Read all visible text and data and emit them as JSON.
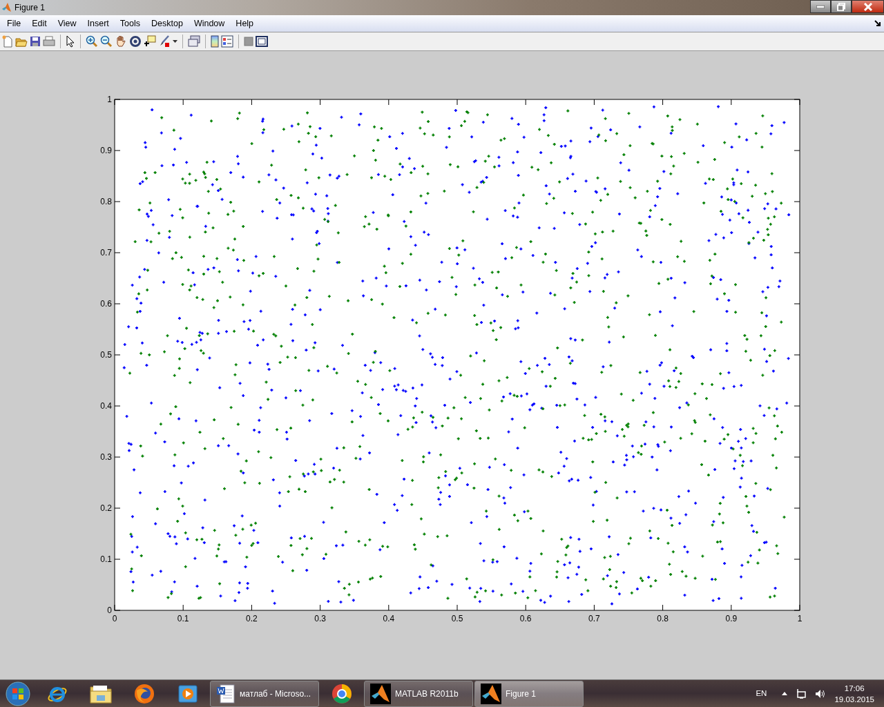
{
  "window": {
    "title": "Figure 1"
  },
  "menu": [
    {
      "label": "File"
    },
    {
      "label": "Edit"
    },
    {
      "label": "View"
    },
    {
      "label": "Insert"
    },
    {
      "label": "Tools"
    },
    {
      "label": "Desktop"
    },
    {
      "label": "Window"
    },
    {
      "label": "Help"
    }
  ],
  "axes": {
    "x_ticks": [
      "0",
      "0.1",
      "0.2",
      "0.3",
      "0.4",
      "0.5",
      "0.6",
      "0.7",
      "0.8",
      "0.9",
      "1"
    ],
    "y_ticks": [
      "1",
      "0.9",
      "0.8",
      "0.7",
      "0.6",
      "0.5",
      "0.4",
      "0.3",
      "0.2",
      "0.1",
      "0"
    ],
    "point_sets": [
      {
        "color": "#0000ff"
      },
      {
        "color": "#008000"
      }
    ]
  },
  "taskbar": {
    "tasks": [
      {
        "kind": "pinned"
      },
      {
        "kind": "pinned"
      },
      {
        "kind": "pinned"
      },
      {
        "kind": "pinned"
      },
      {
        "kind": "window",
        "label": "матлаб - Microso...",
        "selected": false
      },
      {
        "kind": "pinned"
      },
      {
        "kind": "window",
        "label": "MATLAB  R2011b",
        "selected": false
      },
      {
        "kind": "window",
        "label": "Figure 1",
        "selected": true
      }
    ],
    "language": "EN",
    "time": "17:06",
    "date": "19.03.2015"
  }
}
